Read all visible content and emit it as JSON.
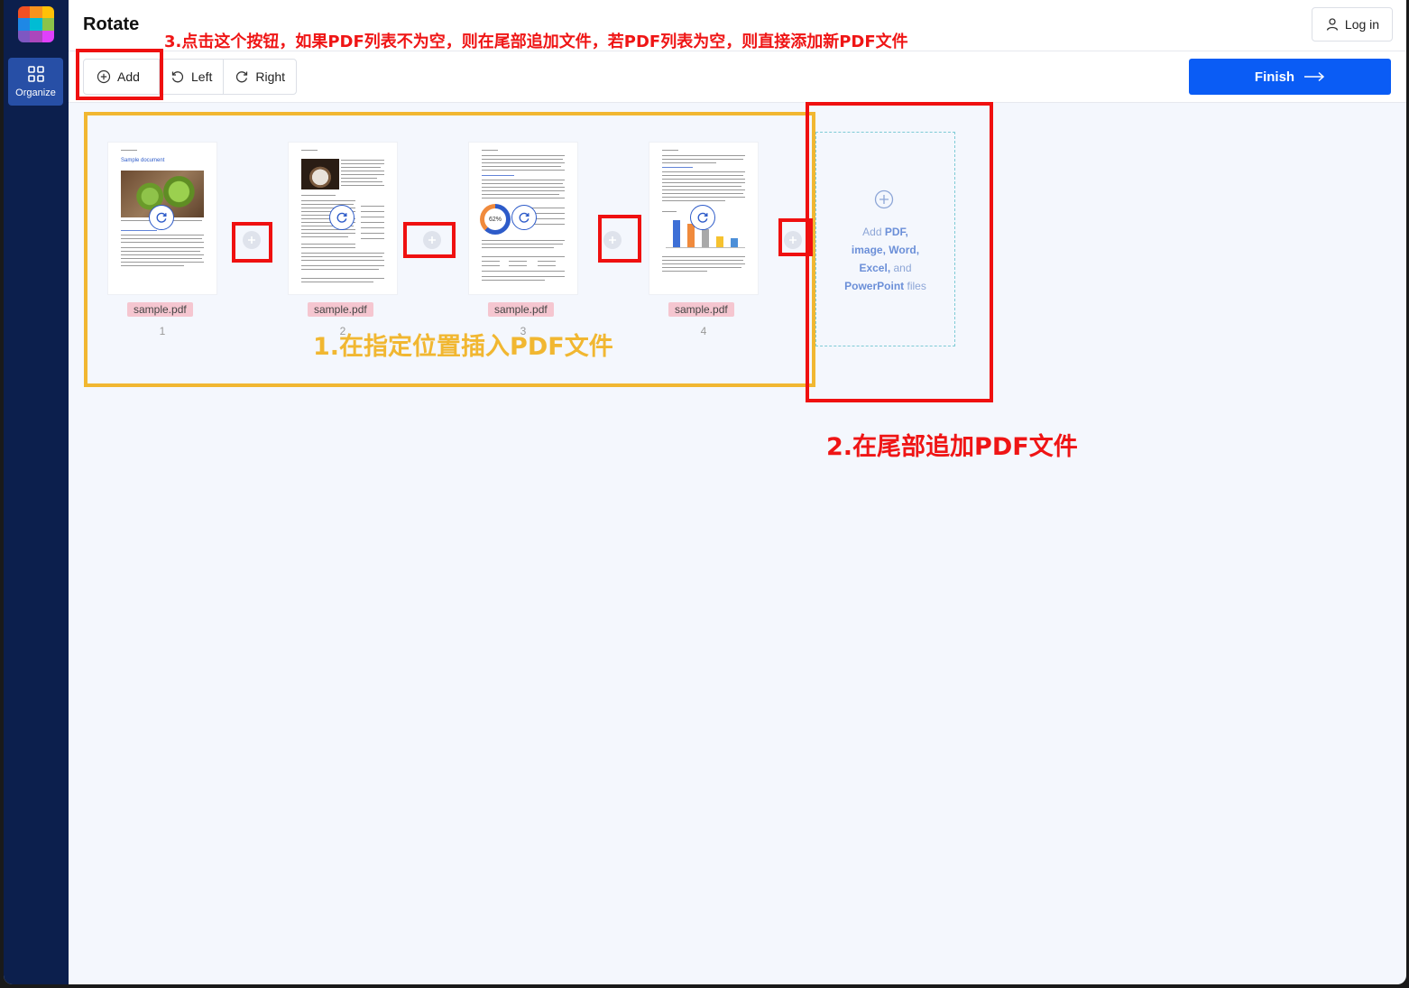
{
  "app": {
    "title": "Rotate",
    "login_label": "Log in"
  },
  "sidebar": {
    "organize_label": "Organize"
  },
  "toolbar": {
    "add_label": "Add",
    "left_label": "Left",
    "right_label": "Right",
    "finish_label": "Finish"
  },
  "pages": [
    {
      "file": "sample.pdf",
      "number": "1"
    },
    {
      "file": "sample.pdf",
      "number": "2"
    },
    {
      "file": "sample.pdf",
      "number": "3"
    },
    {
      "file": "sample.pdf",
      "number": "4"
    }
  ],
  "dropzone": {
    "add": "Add",
    "pdf": "PDF,",
    "image": "image,",
    "word": "Word,",
    "excel": "Excel,",
    "and": "and",
    "powerpoint": "PowerPoint",
    "files": "files"
  },
  "thumbnails": {
    "page1_heading": "Sample document",
    "page3_donut": "62%"
  },
  "annotations": {
    "note3": "3.点击这个按钮，如果PDF列表不为空，则在尾部追加文件，若PDF列表为空，则直接添加新PDF文件",
    "note1": "1.在指定位置插入PDF文件",
    "note2": "2.在尾部追加PDF文件"
  },
  "colors": {
    "sidebar_bg": "#0c1f4d",
    "primary_button": "#0a5cf5",
    "annotation_red": "#ef1010",
    "annotation_yellow": "#f1b731",
    "file_label_bg": "#f5c6d0"
  },
  "icons": [
    "grid-icon",
    "user-icon",
    "plus-circle-icon",
    "rotate-left-icon",
    "rotate-right-icon",
    "arrow-right-icon"
  ]
}
